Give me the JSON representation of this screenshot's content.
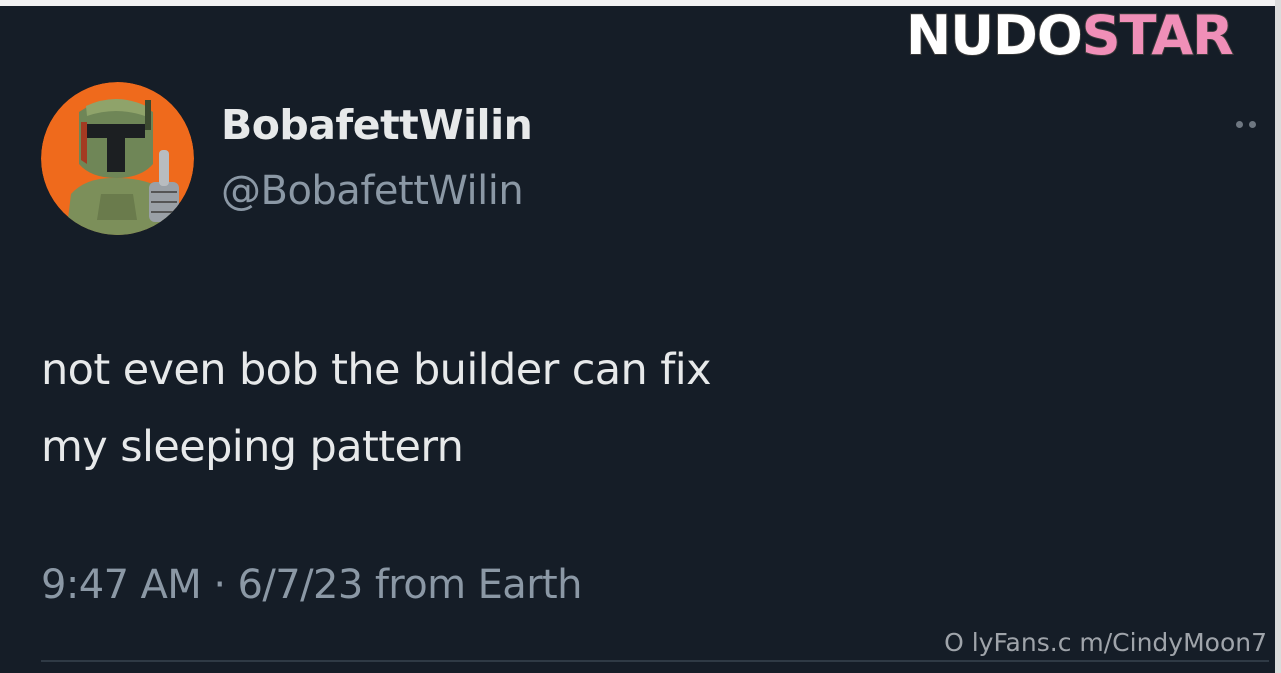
{
  "tweet": {
    "display_name": "BobafettWilin",
    "handle": "@BobafettWilin",
    "text_lines": [
      "not even bob the builder can fix",
      "my sleeping pattern"
    ],
    "meta": "9:47 AM · 6/7/23 from Earth",
    "more_icon": "more-dots-icon",
    "avatar_icon": "boba-fett-avatar"
  },
  "watermark": {
    "logo_part_a": "NUDO",
    "logo_part_b": "STAR",
    "url": "O lyFans.c m/CindyMoon7"
  },
  "colors": {
    "background": "#151d27",
    "primary_text": "#e7e9ea",
    "secondary_text": "#8b98a5",
    "avatar_bg": "#ef6a1c",
    "logo_accent": "#f08fb8"
  }
}
